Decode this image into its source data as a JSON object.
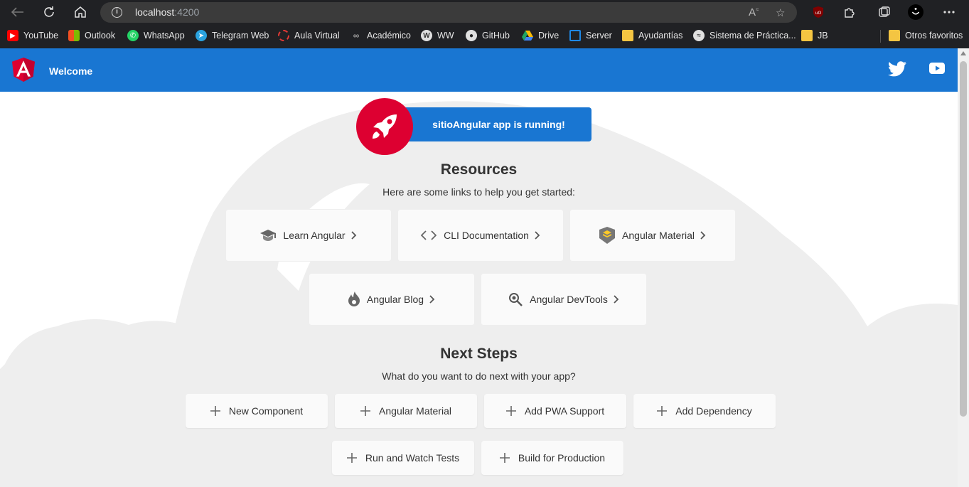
{
  "browser": {
    "url_host": "localhost",
    "url_port": ":4200",
    "bookmarks": [
      {
        "label": "YouTube",
        "icon": "youtube-icon",
        "color": "#ff0000"
      },
      {
        "label": "Outlook",
        "icon": "microsoft-icon",
        "color": "#f25022"
      },
      {
        "label": "WhatsApp",
        "icon": "whatsapp-icon",
        "color": "#25d366"
      },
      {
        "label": "Telegram Web",
        "icon": "telegram-icon",
        "color": "#2aa3df"
      },
      {
        "label": "Aula Virtual",
        "icon": "aula-icon",
        "color": "#e53935"
      },
      {
        "label": "Académico",
        "icon": "link-icon",
        "color": "#9e9e9e"
      },
      {
        "label": "WW",
        "icon": "wordpress-icon",
        "color": "#e0e0e0"
      },
      {
        "label": "GitHub",
        "icon": "github-icon",
        "color": "#e0e0e0"
      },
      {
        "label": "Drive",
        "icon": "drive-icon",
        "color": "#fbbc04"
      },
      {
        "label": "Server",
        "icon": "server-icon",
        "color": "#1e88e5"
      },
      {
        "label": "Ayudantías",
        "icon": "folder-icon",
        "color": "#f4c542"
      },
      {
        "label": "Sistema de Práctica...",
        "icon": "sistema-icon",
        "color": "#e0e0e0"
      },
      {
        "label": "JB",
        "icon": "folder-icon",
        "color": "#f4c542"
      }
    ],
    "other_favorites": "Otros favoritos"
  },
  "toolbar": {
    "title": "Welcome"
  },
  "hero": {
    "running_text": "sitioAngular app is running!"
  },
  "resources": {
    "title": "Resources",
    "subtitle": "Here are some links to help you get started:",
    "cards": [
      {
        "label": "Learn Angular",
        "icon": "graduation-cap-icon"
      },
      {
        "label": "CLI Documentation",
        "icon": "code-icon"
      },
      {
        "label": "Angular Material",
        "icon": "material-layers-icon"
      },
      {
        "label": "Angular Blog",
        "icon": "flame-icon"
      },
      {
        "label": "Angular DevTools",
        "icon": "devtools-search-icon"
      }
    ]
  },
  "next_steps": {
    "title": "Next Steps",
    "subtitle": "What do you want to do next with your app?",
    "steps": [
      {
        "label": "New Component"
      },
      {
        "label": "Angular Material"
      },
      {
        "label": "Add PWA Support"
      },
      {
        "label": "Add Dependency"
      },
      {
        "label": "Run and Watch Tests"
      },
      {
        "label": "Build for Production"
      }
    ]
  },
  "colors": {
    "primary": "#1976d2",
    "angular_red": "#dd0031",
    "card_bg": "#fafafa",
    "cloud": "#eeeeee"
  }
}
